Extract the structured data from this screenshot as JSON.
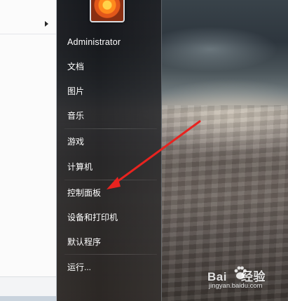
{
  "start_menu": {
    "user_name": "Administrator",
    "items": [
      {
        "label": "文档"
      },
      {
        "label": "图片"
      },
      {
        "label": "音乐"
      },
      {
        "label": "游戏"
      },
      {
        "label": "计算机"
      },
      {
        "label": "控制面板"
      },
      {
        "label": "设备和打印机"
      },
      {
        "label": "默认程序"
      },
      {
        "label": "运行..."
      }
    ]
  },
  "left_pane": {
    "expand_icon": "arrow-right-icon"
  },
  "annotation": {
    "color": "#e8231f",
    "points_to": "控制面板"
  },
  "watermark": {
    "logo_text_left": "Bai",
    "logo_text_right": "经验",
    "url": "jingyan.baidu.com"
  },
  "colors": {
    "menu_text": "#ffffff",
    "left_pane_bg": "#fbfbfb",
    "right_pane_bg": "#1a1b1e"
  }
}
